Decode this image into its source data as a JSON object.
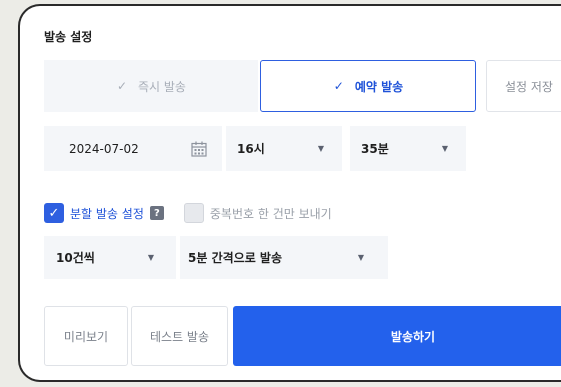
{
  "section": {
    "title": "발송 설정"
  },
  "mode_tabs": {
    "immediate_label": "즉시 발송",
    "reserve_label": "예약 발송",
    "save_label": "설정 저장",
    "check_glyph": "✓",
    "selected": "예약 발송"
  },
  "schedule": {
    "date": "2024-07-02",
    "hour": "16시",
    "minute": "35분",
    "caret": "▼"
  },
  "options": {
    "split_label": "분할 발송 설정",
    "split_checked": true,
    "help_glyph": "?",
    "dedupe_label": "중복번호 한 건만 보내기",
    "dedupe_checked": false,
    "check_glyph": "✓"
  },
  "split": {
    "count": "10건씩",
    "interval": "5분 간격으로 발송"
  },
  "actions": {
    "preview_label": "미리보기",
    "test_label": "테스트 발송",
    "send_label": "발송하기"
  },
  "colors": {
    "accent": "#2e5fe0",
    "send_button": "#2361ec",
    "field_bg": "#f4f6f9"
  }
}
